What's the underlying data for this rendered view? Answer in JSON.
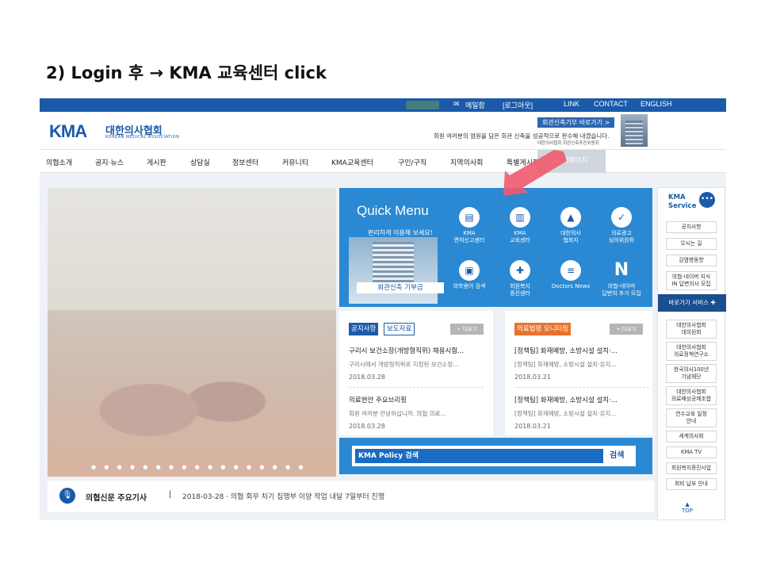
{
  "slide_title": "2) Login 후 → KMA 교육센터 click",
  "topbar": {
    "mypage_label": "메일함",
    "logout": "[로그아웃]",
    "link": "LINK",
    "contact": "CONTACT",
    "english": "ENGLISH"
  },
  "header": {
    "logo_mark": "KMA",
    "logo_kor": "대한의사협회",
    "logo_eng": "KOREAN MEDICAL ASSOCIATION",
    "banner_button": "회관신축기부 바로가기 >",
    "banner_text": "회원 여러분의 염원을 담은 회관 신축을 성공적으로 완수해 내겠습니다.",
    "banner_sub": "대한의사협회 회관신축추진위원회"
  },
  "nav": {
    "items": [
      "의협소개",
      "공지·뉴스",
      "게시판",
      "상담실",
      "정보센터",
      "커뮤니티",
      "KMA교육센터",
      "구인/구직",
      "지역의사회",
      "특별게시판"
    ],
    "mypage": "마이페이지"
  },
  "quick_menu": {
    "title": "Quick Menu",
    "subtitle": "편리하게 이용해 보세요!",
    "donation_button": "회관신축 기부금",
    "items": [
      {
        "label": "KMA\n면허신고센터",
        "icon": "id-card-icon",
        "glyph": "▤"
      },
      {
        "label": "KMA\n교육센터",
        "icon": "book-icon",
        "glyph": "▥"
      },
      {
        "label": "대한의사\n협회지",
        "icon": "graduation-cap-icon",
        "glyph": "▲"
      },
      {
        "label": "의료광고\n심의위원회",
        "icon": "checklist-icon",
        "glyph": "✓"
      },
      {
        "label": "의학용어 검색",
        "icon": "dictionary-icon",
        "glyph": "▣"
      },
      {
        "label": "회원복지\n증진센터",
        "icon": "medical-kit-icon",
        "glyph": "✚"
      },
      {
        "label": "Doctors News",
        "icon": "news-icon",
        "glyph": "≡"
      },
      {
        "label": "의협-네이버\n답변의 추가 모집",
        "icon": "naver-icon",
        "glyph": "N"
      }
    ]
  },
  "notice_panel": {
    "tab_active": "공지사항",
    "tab_inactive": "보도자료",
    "more": "+ 더보기",
    "articles": [
      {
        "title": "구리시 보건소장(개방형직위) 채용시험...",
        "preview": "구리시에서 개방형직위로 지정된 보건소장...",
        "date": "2018.03.28"
      },
      {
        "title": "의료현안 주요브리핑",
        "preview": "회원 여러분 안녕하십니까. 의협 의료...",
        "date": "2018.03.28"
      }
    ]
  },
  "monitor_panel": {
    "tab": "의료법령 모니터링",
    "more": "+ 더보기",
    "articles": [
      {
        "title": "[정책팀] 화재예방, 소방시설 설치·...",
        "preview": "[정책팀] 화재예방, 소방시설 설치·유지...",
        "date": "2018.03.21"
      },
      {
        "title": "[정책팀] 화재예방, 소방시설 설치·...",
        "preview": "[정책팀] 화재예방, 소방시설 설치·유지...",
        "date": "2018.03.21"
      }
    ]
  },
  "policy": {
    "label": "KMA Policy 검색",
    "button": "검색"
  },
  "news_bar": {
    "title": "의협신문 주요기사",
    "separator": "|",
    "headline": "2018-03-28 · 의협 회무 차기 집행부 이양 작업 내달 7일부터 진행"
  },
  "sidebar": {
    "title": "KMA\nService",
    "buttons_top": [
      "공지사항",
      "오시는 길",
      "감염병동향",
      "의협-네이버 지식\nIN 답변의사 모집"
    ],
    "section_header": "바로가기 서비스 ✚",
    "buttons_bottom": [
      "대한의사협회\n대의원회",
      "대한의사협회\n의료정책연구소",
      "한국의사100년\n기념재단",
      "대한의사협회\n의료배상공제조합",
      "연수교육 일정\n안내",
      "세계의사회",
      "KMA TV",
      "회원복지증진사업",
      "회비 납부 안내"
    ],
    "top": "▲\nTOP"
  },
  "colors": {
    "brand_blue": "#1a5aa9",
    "quick_blue": "#2a89d2",
    "orange": "#e8722c",
    "arrow_pink": "#ef5b6e"
  }
}
